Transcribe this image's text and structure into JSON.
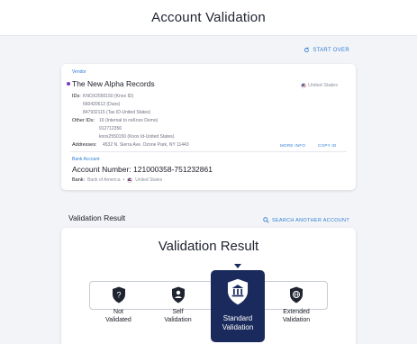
{
  "header": {
    "title": "Account Validation"
  },
  "actions": {
    "start_over": "START OVER",
    "search_another": "SEARCH ANOTHER ACCOUNT"
  },
  "vendor": {
    "section_label": "Vendor",
    "name": "The New Alpha Records",
    "country": "United States",
    "ids_label": "IDs:",
    "ids": [
      "KNOX2550150 (Knox ID)",
      "660420612 (Duns)",
      "847932115 (Tax ID-United States)"
    ],
    "other_ids_label": "Other IDs:",
    "other_ids": [
      "16 (Internal to nsKnox Demo)",
      "912712356",
      "knox2550150 (Knox Id-United States)"
    ],
    "addresses_label": "Addresses:",
    "address": "4532 N. Sierra Ave. Ozone Park, NY 11443",
    "more_info": "MORE INFO",
    "copy_id": "COPY ID"
  },
  "bank_account": {
    "section_label": "Bank Account",
    "account_number": "Account Number: 121000358-751232861",
    "bank_label": "Bank:",
    "bank_name": "Bank of America",
    "bank_country": "United States"
  },
  "validation": {
    "heading": "Validation Result",
    "card_title": "Validation Result",
    "levels": [
      {
        "line1": "Not",
        "line2": "Validated",
        "icon": "question-shield-icon"
      },
      {
        "line1": "Self",
        "line2": "Validation",
        "icon": "user-shield-icon"
      },
      {
        "line1": "Standard",
        "line2": "Validation",
        "icon": "bank-shield-icon",
        "active": true
      },
      {
        "line1": "Extended",
        "line2": "Validation",
        "icon": "globe-shield-icon"
      }
    ]
  },
  "colors": {
    "accent": "#2f7fd6",
    "active_level": "#1b2a5c",
    "vendor_dot": "#7a3cc4"
  }
}
